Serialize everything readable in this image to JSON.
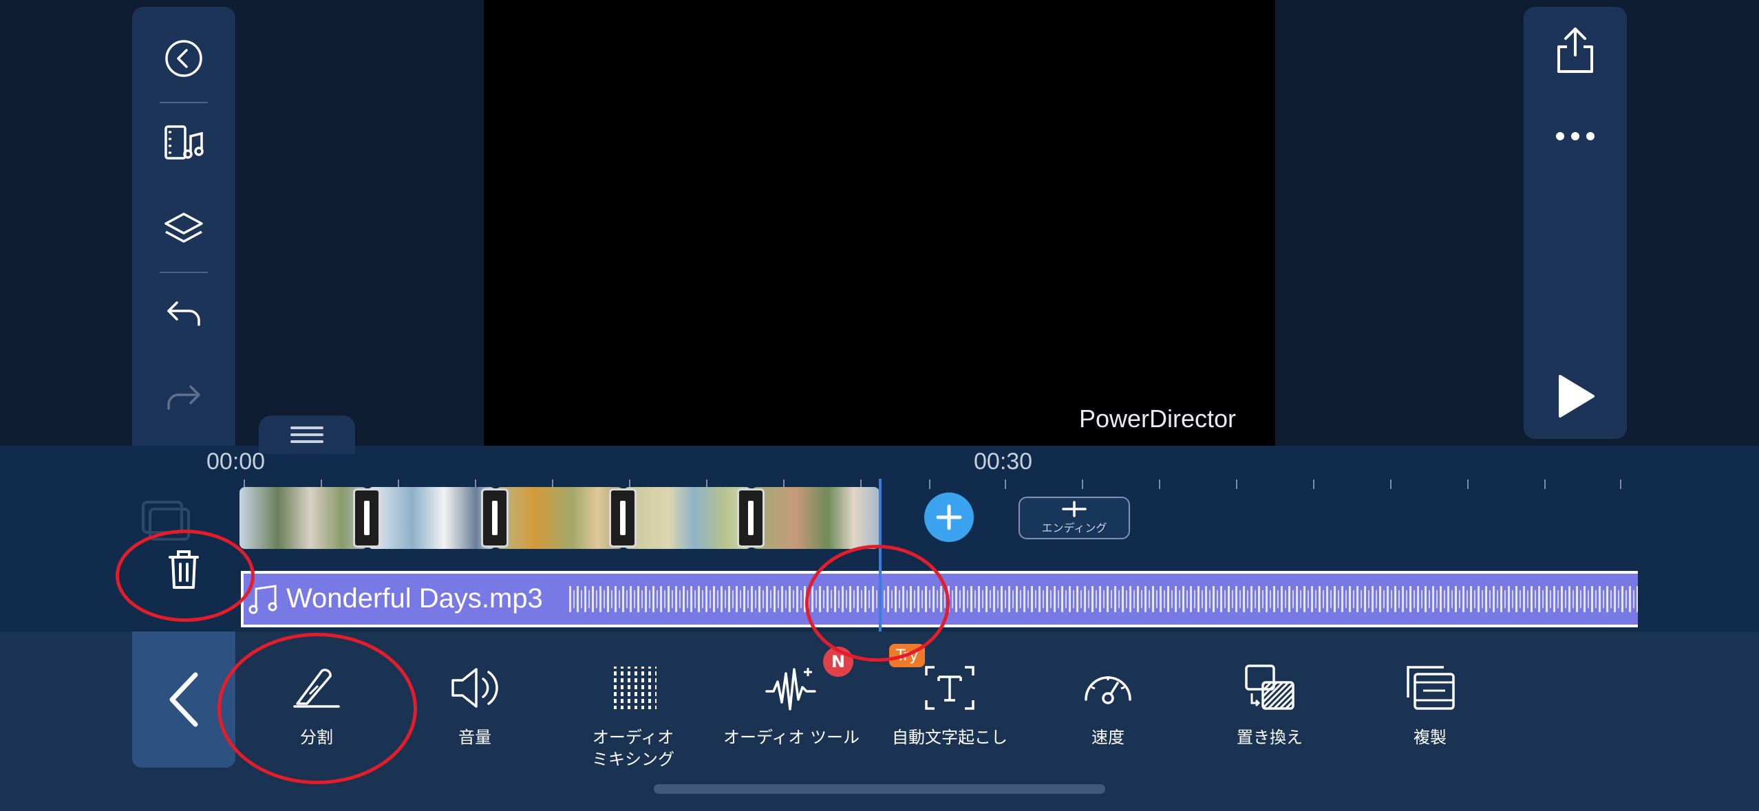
{
  "preview": {
    "watermark": "PowerDirector"
  },
  "timeline": {
    "time_start": "00:00",
    "time_mid": "00:30",
    "ending_label": "エンディング",
    "audio_clip_name": "Wonderful Days.mp3"
  },
  "toolbar": {
    "tools": [
      {
        "label": "分割"
      },
      {
        "label": "音量"
      },
      {
        "label": "オーディオ\nミキシング"
      },
      {
        "label": "オーディオ ツール",
        "badge": "N"
      },
      {
        "label": "自動文字起こし",
        "badge": "Try"
      },
      {
        "label": "速度"
      },
      {
        "label": "置き換え"
      },
      {
        "label": "複製"
      }
    ]
  },
  "colors": {
    "background": "#0f1d33",
    "panel": "#1b3457",
    "accent_blue": "#3ba3f0",
    "audio_track": "#7979e6",
    "annotation_red": "#e51d2a"
  }
}
